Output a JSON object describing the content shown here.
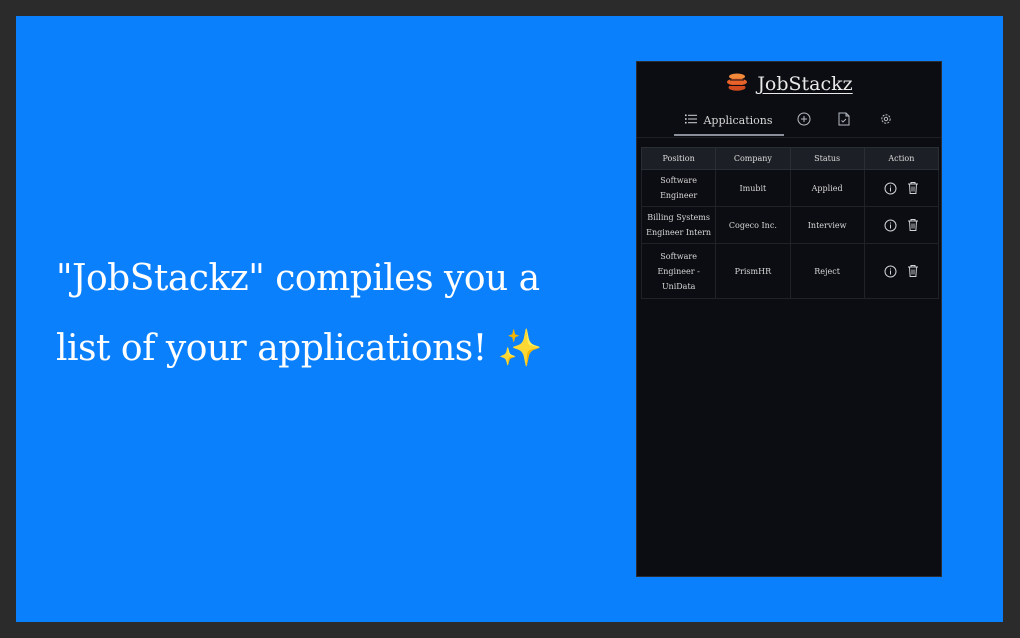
{
  "promo": {
    "headline_line1": "\"JobStackz\" compiles you a",
    "headline_line2": "list of your applications! ",
    "sparkle": "✨",
    "background_color": "#0a80fd"
  },
  "popup": {
    "brand": "JobStackz",
    "tabs": [
      {
        "label": "Applications",
        "icon": "list-icon",
        "active": true
      },
      {
        "label": "",
        "icon": "plus-circle-icon",
        "active": false
      },
      {
        "label": "",
        "icon": "document-icon",
        "active": false
      },
      {
        "label": "",
        "icon": "gear-icon",
        "active": false
      }
    ],
    "table": {
      "columns": [
        "Position",
        "Company",
        "Status",
        "Action"
      ],
      "rows": [
        {
          "position": "Software Engineer",
          "company": "Imubit",
          "status": "Applied"
        },
        {
          "position": "Billing Systems Engineer Intern",
          "company": "Cogeco Inc.",
          "status": "Interview"
        },
        {
          "position": "Software Engineer - UniData",
          "company": "PrismHR",
          "status": "Reject"
        }
      ],
      "action_icons": [
        "info-icon",
        "trash-icon"
      ]
    }
  }
}
